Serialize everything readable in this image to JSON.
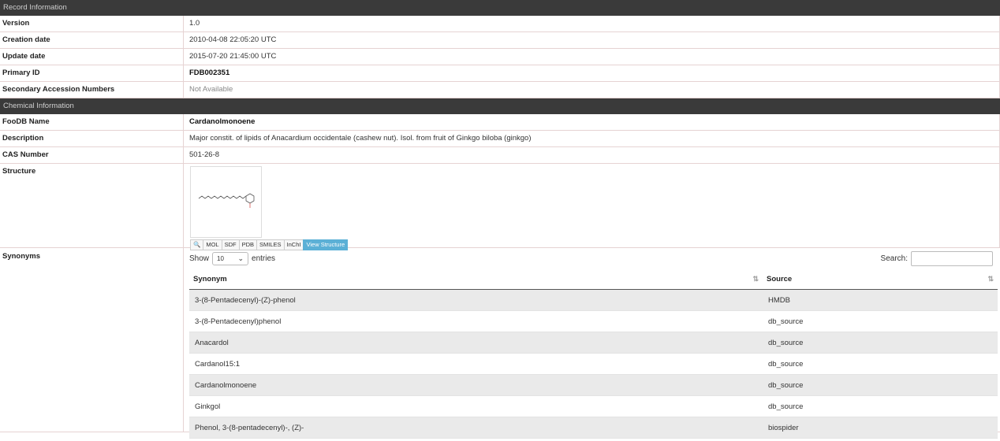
{
  "record_section": "Record Information",
  "record": {
    "version_label": "Version",
    "version": "1.0",
    "creation_label": "Creation date",
    "creation": "2010-04-08 22:05:20 UTC",
    "update_label": "Update date",
    "update": "2015-07-20 21:45:00 UTC",
    "primary_label": "Primary ID",
    "primary": "FDB002351",
    "secondary_label": "Secondary Accession Numbers",
    "secondary": "Not Available"
  },
  "chemical_section": "Chemical Information",
  "chemical": {
    "name_label": "FooDB Name",
    "name": "Cardanolmonoene",
    "desc_label": "Description",
    "desc": "Major constit. of lipids of Anacardium occidentale (cashew nut). Isol. from fruit of Ginkgo biloba (ginkgo)",
    "cas_label": "CAS Number",
    "cas": "501-26-8",
    "structure_label": "Structure",
    "formats": [
      "MOL",
      "SDF",
      "PDB",
      "SMILES",
      "InChI"
    ],
    "view_structure": "View Structure",
    "synonyms_label": "Synonyms"
  },
  "synonyms_table": {
    "show_label": "Show",
    "show_value": "10",
    "entries_label": "entries",
    "search_label": "Search:",
    "columns": [
      "Synonym",
      "Source"
    ],
    "rows": [
      [
        "3-(8-Pentadecenyl)-(Z)-phenol",
        "HMDB"
      ],
      [
        "3-(8-Pentadecenyl)phenol",
        "db_source"
      ],
      [
        "Anacardol",
        "db_source"
      ],
      [
        "Cardanol15:1",
        "db_source"
      ],
      [
        "Cardanolmonoene",
        "db_source"
      ],
      [
        "Ginkgol",
        "db_source"
      ],
      [
        "Phenol, 3-(8-pentadecenyl)-, (Z)-",
        "biospider"
      ]
    ]
  }
}
